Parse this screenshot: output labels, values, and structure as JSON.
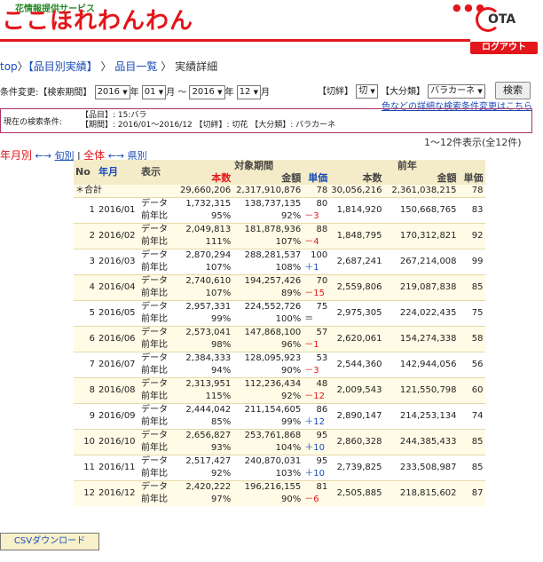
{
  "header": {
    "subtitle": "花情報提供サービス",
    "logo": "ここほれわんわん",
    "brand": "OTA",
    "logout": "ログアウト"
  },
  "breadcrumb": {
    "top": "top",
    "sep1": "〉",
    "item1": "【品目別実績】",
    "sep2": "〉",
    "item2": "品目一覧",
    "sep3": "〉",
    "item3": "実績詳細"
  },
  "search": {
    "label": "条件変更:【検索期間】",
    "from_year": "2016",
    "year_suffix": "年",
    "from_month": "01",
    "month_suffix": "月",
    "tilde": "～",
    "to_year": "2016",
    "to_month": "12",
    "cut_label": "【切絆】",
    "cut_value": "切",
    "class_label": "【大分類】",
    "class_value": "バラカーネ",
    "search_button": "検索",
    "detail_link": "色などの詳細な検索条件変更はこちら"
  },
  "current": {
    "label": "現在の検索条件:",
    "line1": "【品目】: 15:バラ",
    "line2": "【期間】: 2016/01～2016/12 【切絆】: 切花 【大分類】: バラカーネ"
  },
  "pagecount": "1～12件表示(全12件)",
  "mode": {
    "monthly": "年月別",
    "arrow1": "←→",
    "weekly": "旬別",
    "sep": "|",
    "all": "全体",
    "arrow2": "←→",
    "prefecture": "県別"
  },
  "table": {
    "h_no": "No",
    "h_month": "年月",
    "h_disp": "表示",
    "h_period": "対象期間",
    "h_prev": "前年",
    "h_qty": "本数",
    "h_amount": "金額",
    "h_unit": "単価",
    "total_label": "＊合計",
    "total": {
      "qty": "29,660,206",
      "amount": "2,317,910,876",
      "unit": "78",
      "pqty": "30,056,216",
      "pamount": "2,361,038,215",
      "punit": "78"
    },
    "rows": [
      {
        "no": "1",
        "month": "2016/01",
        "d1": "データ",
        "d2": "前年比",
        "qty": "1,732,315",
        "amount": "138,737,135",
        "unit": "80",
        "qty_r": "95%",
        "amount_r": "92%",
        "unit_d": "－3",
        "cls": "neg",
        "pqty": "1,814,920",
        "pamount": "150,668,765",
        "punit": "83"
      },
      {
        "no": "2",
        "month": "2016/02",
        "d1": "データ",
        "d2": "前年比",
        "qty": "2,049,813",
        "amount": "181,878,936",
        "unit": "88",
        "qty_r": "111%",
        "amount_r": "107%",
        "unit_d": "－4",
        "cls": "neg",
        "pqty": "1,848,795",
        "pamount": "170,312,821",
        "punit": "92"
      },
      {
        "no": "3",
        "month": "2016/03",
        "d1": "データ",
        "d2": "前年比",
        "qty": "2,870,294",
        "amount": "288,281,537",
        "unit": "100",
        "qty_r": "107%",
        "amount_r": "108%",
        "unit_d": "＋1",
        "cls": "pos",
        "pqty": "2,687,241",
        "pamount": "267,214,008",
        "punit": "99"
      },
      {
        "no": "4",
        "month": "2016/04",
        "d1": "データ",
        "d2": "前年比",
        "qty": "2,740,610",
        "amount": "194,257,426",
        "unit": "70",
        "qty_r": "107%",
        "amount_r": "89%",
        "unit_d": "－15",
        "cls": "neg",
        "pqty": "2,559,806",
        "pamount": "219,087,838",
        "punit": "85"
      },
      {
        "no": "5",
        "month": "2016/05",
        "d1": "データ",
        "d2": "前年比",
        "qty": "2,957,331",
        "amount": "224,552,726",
        "unit": "75",
        "qty_r": "99%",
        "amount_r": "100%",
        "unit_d": "＝",
        "cls": "",
        "pqty": "2,975,305",
        "pamount": "224,022,435",
        "punit": "75"
      },
      {
        "no": "6",
        "month": "2016/06",
        "d1": "データ",
        "d2": "前年比",
        "qty": "2,573,041",
        "amount": "147,868,100",
        "unit": "57",
        "qty_r": "98%",
        "amount_r": "96%",
        "unit_d": "－1",
        "cls": "neg",
        "pqty": "2,620,061",
        "pamount": "154,274,338",
        "punit": "58"
      },
      {
        "no": "7",
        "month": "2016/07",
        "d1": "データ",
        "d2": "前年比",
        "qty": "2,384,333",
        "amount": "128,095,923",
        "unit": "53",
        "qty_r": "94%",
        "amount_r": "90%",
        "unit_d": "－3",
        "cls": "neg",
        "pqty": "2,544,360",
        "pamount": "142,944,056",
        "punit": "56"
      },
      {
        "no": "8",
        "month": "2016/08",
        "d1": "データ",
        "d2": "前年比",
        "qty": "2,313,951",
        "amount": "112,236,434",
        "unit": "48",
        "qty_r": "115%",
        "amount_r": "92%",
        "unit_d": "－12",
        "cls": "neg",
        "pqty": "2,009,543",
        "pamount": "121,550,798",
        "punit": "60"
      },
      {
        "no": "9",
        "month": "2016/09",
        "d1": "データ",
        "d2": "前年比",
        "qty": "2,444,042",
        "amount": "211,154,605",
        "unit": "86",
        "qty_r": "85%",
        "amount_r": "99%",
        "unit_d": "＋12",
        "cls": "pos",
        "pqty": "2,890,147",
        "pamount": "214,253,134",
        "punit": "74"
      },
      {
        "no": "10",
        "month": "2016/10",
        "d1": "データ",
        "d2": "前年比",
        "qty": "2,656,827",
        "amount": "253,761,868",
        "unit": "95",
        "qty_r": "93%",
        "amount_r": "104%",
        "unit_d": "＋10",
        "cls": "pos",
        "pqty": "2,860,328",
        "pamount": "244,385,433",
        "punit": "85"
      },
      {
        "no": "11",
        "month": "2016/11",
        "d1": "データ",
        "d2": "前年比",
        "qty": "2,517,427",
        "amount": "240,870,031",
        "unit": "95",
        "qty_r": "92%",
        "amount_r": "103%",
        "unit_d": "＋10",
        "cls": "pos",
        "pqty": "2,739,825",
        "pamount": "233,508,987",
        "punit": "85"
      },
      {
        "no": "12",
        "month": "2016/12",
        "d1": "データ",
        "d2": "前年比",
        "qty": "2,420,222",
        "amount": "196,216,155",
        "unit": "81",
        "qty_r": "97%",
        "amount_r": "90%",
        "unit_d": "－6",
        "cls": "neg",
        "pqty": "2,505,885",
        "pamount": "218,815,602",
        "punit": "87"
      }
    ]
  },
  "csv_button": "CSVダウンロード"
}
